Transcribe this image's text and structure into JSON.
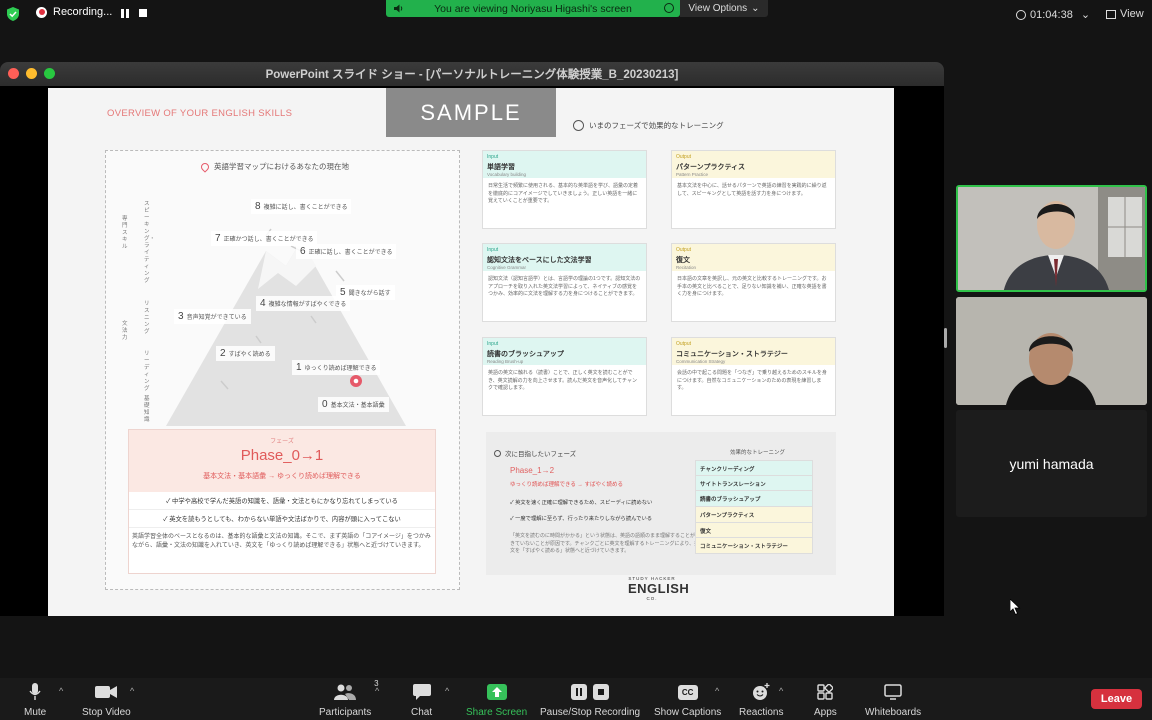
{
  "topbar": {
    "recording_label": "Recording...",
    "viewing_banner": "You are viewing Noriyasu Higashi's screen",
    "view_options_label": "View Options",
    "meeting_timer": "01:04:38",
    "view_label": "View"
  },
  "window": {
    "title": "PowerPoint スライド ショー - [パーソナルトレーニング体験授業_B_20230213]"
  },
  "slide": {
    "overview_title": "OVERVIEW OF YOUR ENGLISH SKILLS",
    "sample_label": "SAMPLE",
    "phase_training_note": "いまのフェーズで効果的なトレーニング",
    "map_title": "英語学習マップにおけるあなたの現在地",
    "vertical_labels": [
      "専門スキル",
      "スピーキング・ライティング",
      "リスニング",
      "文法力",
      "リーディング",
      "基礎知識"
    ],
    "steps": [
      {
        "num": "8",
        "text": "複雑に話し、書くことができる"
      },
      {
        "num": "7",
        "text": "正確かつ話し、書くことができる"
      },
      {
        "num": "6",
        "text": "正確に話し、書くことができる"
      },
      {
        "num": "5",
        "text": "聞きながら話す"
      },
      {
        "num": "4",
        "text": "複雑な情報がすばやくできる"
      },
      {
        "num": "3",
        "text": "音声知覚ができている"
      },
      {
        "num": "2",
        "text": "すばやく読める"
      },
      {
        "num": "1",
        "text": "ゆっくり読めば理解できる"
      },
      {
        "num": "0",
        "text": "基本文法・基本語彙"
      }
    ],
    "phase_box": {
      "small_label": "フェーズ",
      "phase": "Phase_0→1",
      "subtitle": "基本文法・基本語彙 → ゆっくり読めば理解できる",
      "rows": [
        "✓ 中学や高校で学んだ英語の知識を、語彙・文法ともにかなり忘れてしまっている",
        "✓ 英文を読もうとしても、わからない単語や文法ばかりで、内容が頭に入ってこない"
      ],
      "description": "英語学習全体のベースとなるのは、基本的な語彙と文法の知識。そこで、まず英語の「コアイメージ」をつかみながら、語彙・文法の知識を入れていき、英文を「ゆっくり読めば理解できる」状態へと近づけていきます。"
    },
    "cards": [
      {
        "kind": "in",
        "tag": "Input",
        "name": "単語学習",
        "en": "Vocabulary building",
        "body": "日常生活で頻繁に使用される、基本的な英単語を学び、語彙の定着を徹底的にコアイメージでしていきましょう。正しい英語を一緒に覚えていくことが重要です。"
      },
      {
        "kind": "out",
        "tag": "Output",
        "name": "パターンプラクティス",
        "en": "Pattern Practice",
        "body": "基本文法を中心に、話せるパターンで英語の練習を実践的に繰り返して、スピーキングとして英語を話す力を身につけます。"
      },
      {
        "kind": "in",
        "tag": "Input",
        "name": "認知文法をベースにした文法学習",
        "en": "Cognitive Grammar",
        "body": "認知文法（認知言語学）とは、言語学の理論の1つです。認知文法のアプローチを取り入れた英文法学習によって、ネイティブの感覚をつかみ、効率的に文法を理解する力を身につけることができます。"
      },
      {
        "kind": "out",
        "tag": "Output",
        "name": "復文",
        "en": "Recitation",
        "body": "日本語の文章を英訳し、元の英文と比較するトレーニングです。お手本の英文と比べることで、足りない知識を補い、正確な英語を書く力を身につけます。"
      },
      {
        "kind": "in",
        "tag": "Input",
        "name": "読書のブラッシュアップ",
        "en": "Reading Brush-up",
        "body": "英語の英文に触れる（読書）ことで、正しく英文を読むことができ、英文読解の力を向上させます。読んだ英文を音声化してチャンクで確認します。"
      },
      {
        "kind": "out",
        "tag": "Output",
        "name": "コミュニケーション・ストラテジー",
        "en": "Communication Strategy",
        "body": "会話の中で起こる問題を「つなぎ」で乗り越えるためのスキルを身につけます。自然なコミュニケーションのための表現を練習します。"
      }
    ],
    "next_phase": {
      "title": "次に目指したいフェーズ",
      "phase": "Phase_1→2",
      "red_line": "ゆっくり読めば理解できる → すばやく読める",
      "checks": [
        "✓ 英文を速く正確に理解できるため、スピーディに読めない",
        "✓ 一度で理解に至らず、行ったり来たりしながら読んでいる"
      ],
      "note": "「英文を読むのに時間がかかる」という状態は、英語の語順のまま理解することができていないことが原因です。チャンクごとに英文を理解するトレーニングにより、英文を「すばやく読める」状態へと近づけていきます。",
      "list_title": "効果的なトレーニング",
      "list": [
        {
          "kind": "in",
          "label": "チャンクリーディング"
        },
        {
          "kind": "in",
          "label": "サイトトランスレーション"
        },
        {
          "kind": "in",
          "label": "読書のブラッシュアップ"
        },
        {
          "kind": "out",
          "label": "パターンプラクティス"
        },
        {
          "kind": "out",
          "label": "復文"
        },
        {
          "kind": "out",
          "label": "コミュニケーション・ストラテジー"
        }
      ]
    },
    "logo": {
      "small": "STUDY HACKER",
      "main": "ENGLISH",
      "suffix": "CO."
    }
  },
  "participants": {
    "third_name": "yumi hamada"
  },
  "toolbar": {
    "mute": "Mute",
    "stop_video": "Stop Video",
    "participants": "Participants",
    "participants_count": "3",
    "chat": "Chat",
    "share_screen": "Share Screen",
    "pause_stop_recording": "Pause/Stop Recording",
    "show_captions": "Show Captions",
    "reactions": "Reactions",
    "apps": "Apps",
    "whiteboards": "Whiteboards",
    "leave": "Leave",
    "cc_icon_text": "CC"
  },
  "colors": {
    "green_accent": "#22b14c",
    "leave_red": "#d6313e",
    "active_speaker_border": "#30c24a",
    "input_card": "#def6f1",
    "output_card": "#fbf6dc"
  }
}
